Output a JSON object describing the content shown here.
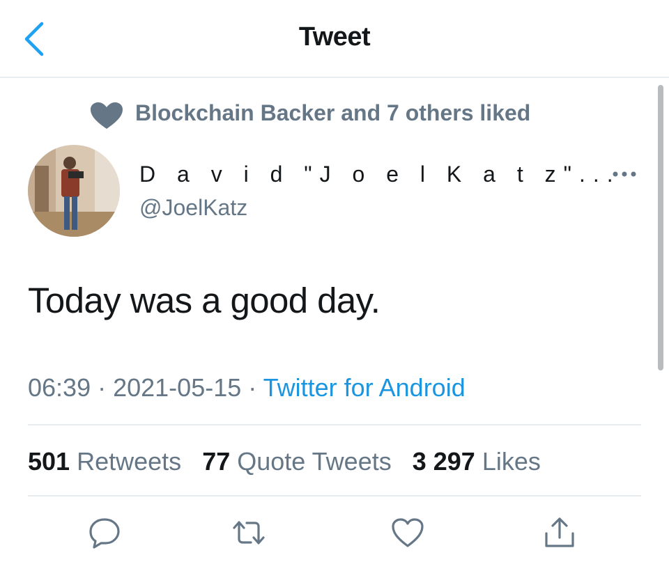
{
  "header": {
    "title": "Tweet"
  },
  "social_context": {
    "text": "Blockchain Backer and 7 others liked"
  },
  "author": {
    "name": "D a v i d  \"J o e l K a t z\"...",
    "handle": "@JoelKatz"
  },
  "tweet": {
    "text": "Today was a good day.",
    "time": "06:39",
    "date": "2021-05-15",
    "source": "Twitter for Android",
    "separator": " · "
  },
  "stats": {
    "retweets_count": "501",
    "retweets_label": "Retweets",
    "quotes_count": "77",
    "quotes_label": "Quote Tweets",
    "likes_count": "3 297",
    "likes_label": "Likes"
  },
  "colors": {
    "accent": "#1da1f2",
    "text": "#14171a",
    "muted": "#657786",
    "divider": "#e6ecf0"
  },
  "icons": {
    "back": "back-chevron-icon",
    "social": "heart-icon",
    "more": "more-dots-icon",
    "reply": "reply-icon",
    "retweet": "retweet-icon",
    "like": "heart-outline-icon",
    "share": "share-icon"
  }
}
